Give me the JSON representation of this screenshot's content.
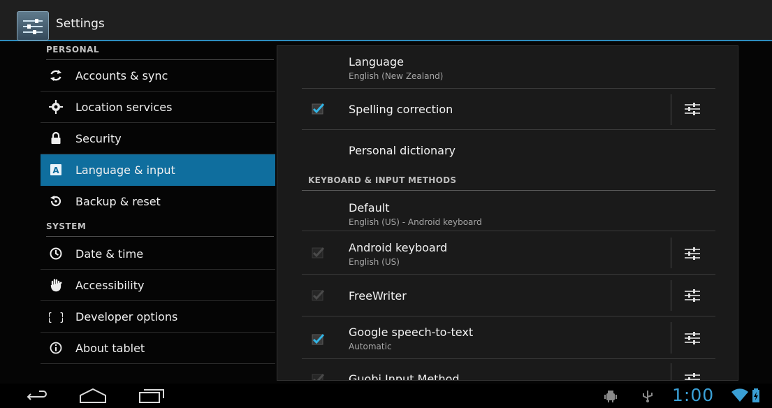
{
  "app": {
    "title": "Settings"
  },
  "headers": {
    "personal": "PERSONAL",
    "system": "SYSTEM",
    "items": [
      {
        "label": "Accounts & sync",
        "icon": "sync-icon"
      },
      {
        "label": "Location services",
        "icon": "location-icon"
      },
      {
        "label": "Security",
        "icon": "lock-icon"
      },
      {
        "label": "Language & input",
        "icon": "language-icon",
        "selected": true
      },
      {
        "label": "Backup & reset",
        "icon": "backup-icon"
      },
      {
        "label": "Date & time",
        "icon": "clock-icon"
      },
      {
        "label": "Accessibility",
        "icon": "hand-icon"
      },
      {
        "label": "Developer options",
        "icon": "braces-icon"
      },
      {
        "label": "About tablet",
        "icon": "info-icon"
      }
    ]
  },
  "detail": {
    "language": {
      "title": "Language",
      "summary": "English (New Zealand)"
    },
    "spelling": {
      "title": "Spelling correction",
      "checked": true
    },
    "dictionary": {
      "title": "Personal dictionary"
    },
    "keyboard_category": "KEYBOARD & INPUT METHODS",
    "default": {
      "title": "Default",
      "summary": "English (US) - Android keyboard"
    },
    "android_keyboard": {
      "title": "Android keyboard",
      "summary": "English (US)",
      "checked": true,
      "enabled": false
    },
    "freewriter": {
      "title": "FreeWriter",
      "checked": true,
      "enabled": false
    },
    "google_speech": {
      "title": "Google speech-to-text",
      "summary": "Automatic",
      "checked": true
    },
    "guobi": {
      "title": "Guobi Input Method"
    }
  },
  "status": {
    "time": "1:00"
  },
  "colors": {
    "accent": "#2e8dbf",
    "selected": "#0f6e9e",
    "clock": "#3aa0d6"
  }
}
